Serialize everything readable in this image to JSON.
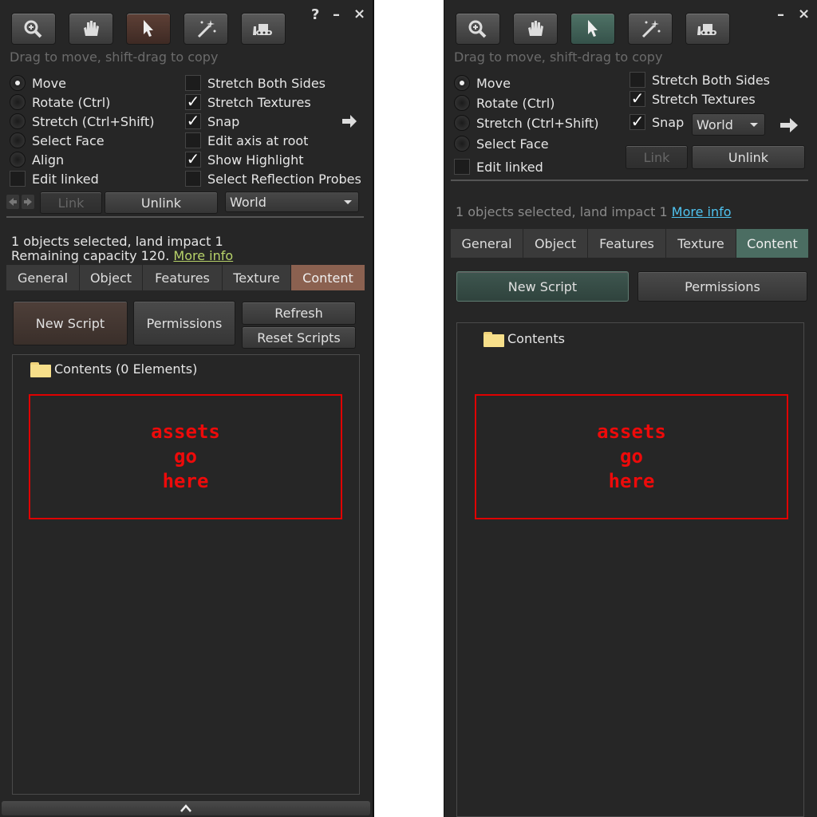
{
  "left": {
    "tools": [
      "zoom-icon",
      "grab-hand-icon",
      "pointer-arrow-icon",
      "magic-wand-icon",
      "bulldozer-icon"
    ],
    "window_controls": {
      "help": "?",
      "minimize": "–",
      "close": "×"
    },
    "hint": "Drag to move, shift-drag to copy",
    "modes": [
      {
        "label": "Move",
        "checked": true
      },
      {
        "label": "Rotate (Ctrl)",
        "checked": false
      },
      {
        "label": "Stretch (Ctrl+Shift)",
        "checked": false
      },
      {
        "label": "Select Face",
        "checked": false
      },
      {
        "label": "Align",
        "checked": false
      }
    ],
    "edit_linked": {
      "label": "Edit linked",
      "checked": false
    },
    "options": [
      {
        "label": "Stretch Both Sides",
        "checked": false
      },
      {
        "label": "Stretch Textures",
        "checked": true
      },
      {
        "label": "Snap",
        "checked": true
      },
      {
        "label": "Edit axis at root",
        "checked": false
      },
      {
        "label": "Show Highlight",
        "checked": true
      },
      {
        "label": "Select Reflection Probes",
        "checked": false
      }
    ],
    "link_label": "Link",
    "unlink_label": "Unlink",
    "ref_frame": "World",
    "status_line1": "1 objects selected, land impact 1",
    "status_line2": "Remaining capacity 120.",
    "more_info": "More info",
    "tabs": [
      "General",
      "Object",
      "Features",
      "Texture",
      "Content"
    ],
    "active_tab": "Content",
    "new_script": "New Script",
    "permissions": "Permissions",
    "refresh": "Refresh",
    "reset_scripts": "Reset Scripts",
    "contents_label": "Contents (0 Elements)",
    "assets_lines": [
      "assets",
      "go",
      "here"
    ]
  },
  "right": {
    "tools": [
      "zoom-icon",
      "grab-hand-icon",
      "pointer-arrow-icon",
      "magic-wand-icon",
      "bulldozer-icon"
    ],
    "window_controls": {
      "minimize": "–",
      "close": "×"
    },
    "hint": "Drag to move, shift-drag to copy",
    "modes": [
      {
        "label": "Move",
        "checked": true
      },
      {
        "label": "Rotate (Ctrl)",
        "checked": false
      },
      {
        "label": "Stretch (Ctrl+Shift)",
        "checked": false
      },
      {
        "label": "Select Face",
        "checked": false
      }
    ],
    "edit_linked": {
      "label": "Edit linked",
      "checked": false
    },
    "options": [
      {
        "label": "Stretch Both Sides",
        "checked": false
      },
      {
        "label": "Stretch Textures",
        "checked": true
      },
      {
        "label": "Snap",
        "checked": true
      }
    ],
    "ref_frame": "World",
    "link_label": "Link",
    "unlink_label": "Unlink",
    "status_line1": "1 objects selected, land impact 1",
    "more_info": "More info",
    "tabs": [
      "General",
      "Object",
      "Features",
      "Texture",
      "Content"
    ],
    "active_tab": "Content",
    "new_script": "New Script",
    "permissions": "Permissions",
    "contents_label": "Contents",
    "assets_lines": [
      "assets",
      "go",
      "here"
    ]
  },
  "colors": {
    "panel_bg": "#262626",
    "left_accent": "#8b6150",
    "right_accent": "#4b6d62",
    "left_link": "#b8d36a",
    "right_link": "#4fc3f0",
    "assets_border": "#e00000"
  }
}
